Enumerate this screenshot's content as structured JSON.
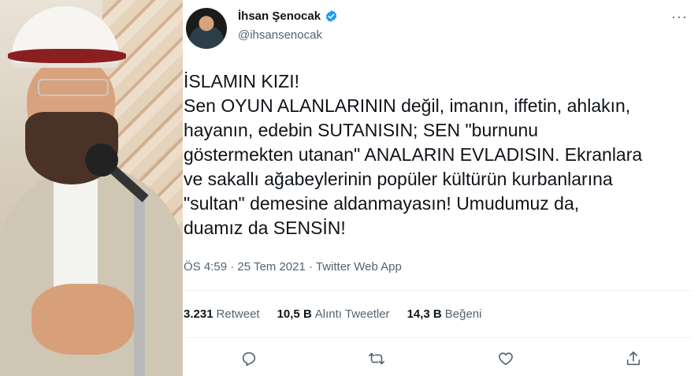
{
  "tweet": {
    "author": {
      "display_name": "İhsan Şenocak",
      "handle": "@ihsansenocak",
      "verified": true
    },
    "text_lines": [
      "İSLAMIN KIZI!",
      "Sen OYUN ALANLARININ değil, imanın, iffetin, ahlakın,",
      "hayanın, edebin SUTANISIN; SEN \"burnunu",
      "göstermekten utanan\" ANALARIN EVLADISIN. Ekranlara",
      "ve sakallı ağabeylerinin popüler kültürün kurbanlarına",
      "\"sultan\" demesine aldanmayasın! Umudumuz da,",
      "duamız da SENSİN!"
    ],
    "meta": "ÖS 4:59 · 25 Tem 2021 · Twitter Web App",
    "stats": [
      {
        "num": "3.231",
        "label": "Retweet"
      },
      {
        "num": "10,5 B",
        "label": "Alıntı Tweetler"
      },
      {
        "num": "14,3 B",
        "label": "Beğeni"
      }
    ],
    "more_label": "···",
    "actions": [
      "reply-icon",
      "retweet-icon",
      "like-icon",
      "share-icon"
    ]
  },
  "colors": {
    "verified": "#1d9bf0",
    "text_primary": "#0f1419",
    "text_secondary": "#536471",
    "divider": "#eff3f4"
  }
}
